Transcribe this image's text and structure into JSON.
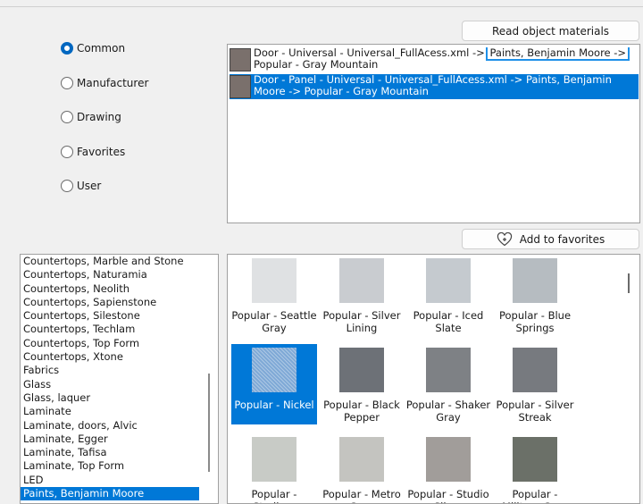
{
  "radios": [
    {
      "label": "Common",
      "checked": true
    },
    {
      "label": "Manufacturer",
      "checked": false
    },
    {
      "label": "Drawing",
      "checked": false
    },
    {
      "label": "Favorites",
      "checked": false
    },
    {
      "label": "User",
      "checked": false
    }
  ],
  "buttons": {
    "read_materials": "Read object materials",
    "add_favorites": "Add to favorites"
  },
  "materials": [
    {
      "text_before": "Door - Universal - Universal_FullAcess.xml -> ",
      "text_highlight": "Paints, Benjamin Moore ->",
      "text_after": "Popular - Gray Mountain",
      "selected": false
    },
    {
      "text_before": "Door - Panel - Universal - Universal_FullAcess.xml -> Paints, Benjamin Moore -> Popular - Gray Mountain",
      "text_highlight": "",
      "text_after": "",
      "selected": true
    }
  ],
  "categories": [
    "Countertops, Marble and Stone",
    "Countertops, Naturamia",
    "Countertops, Neolith",
    "Countertops, Sapienstone",
    "Countertops, Silestone",
    "Countertops, Techlam",
    "Countertops, Top Form",
    "Countertops, Xtone",
    "Fabrics",
    "Glass",
    "Glass, laquer",
    "Laminate",
    "Laminate, doors, Alvic",
    "Laminate, Egger",
    "Laminate, Tafisa",
    "Laminate, Top Form",
    "LED",
    "Paints, Benjamin Moore"
  ],
  "selected_category": "Paints, Benjamin Moore",
  "swatches": [
    {
      "label": "Popular - Seattle Gray",
      "color": "#dfe1e3",
      "selected": false
    },
    {
      "label": "Popular - Silver Lining",
      "color": "#c9ccd0",
      "selected": false
    },
    {
      "label": "Popular - Iced Slate",
      "color": "#c5cacf",
      "selected": false
    },
    {
      "label": "Popular - Blue Springs",
      "color": "#b6bcc1",
      "selected": false
    },
    {
      "label": "Popular - Nickel",
      "color": "#7fa9d6",
      "selected": true
    },
    {
      "label": "Popular - Black Pepper",
      "color": "#6d7177",
      "selected": false
    },
    {
      "label": "Popular - Shaker Gray",
      "color": "#7e8185",
      "selected": false
    },
    {
      "label": "Popular - Silver Streak",
      "color": "#777a7f",
      "selected": false
    },
    {
      "label": "Popular - Stadium",
      "color": "#c8cbc6",
      "selected": false
    },
    {
      "label": "Popular - Metro Gray",
      "color": "#c4c4c0",
      "selected": false
    },
    {
      "label": "Popular - Studio Silver",
      "color": "#a19d9a",
      "selected": false
    },
    {
      "label": "Popular - Military Gray",
      "color": "#6b7068",
      "selected": false
    }
  ],
  "colors": {
    "accent": "#0078d7",
    "radio_checked": "#0067c0",
    "material_swatch": "#7a706c"
  },
  "icons": {
    "add_favorites": "heart-plus-icon"
  }
}
